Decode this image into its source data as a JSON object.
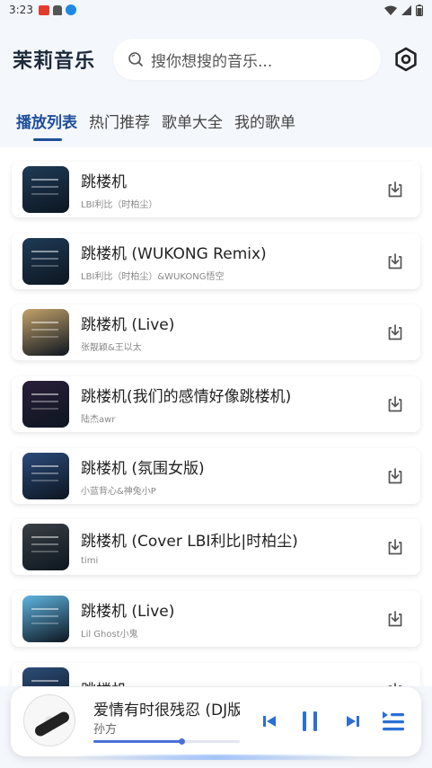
{
  "status_bar": {
    "time": "3:23"
  },
  "header": {
    "app_title": "茉莉音乐",
    "search_placeholder": "搜你想搜的音乐...",
    "settings_icon": "settings-hexagon-icon"
  },
  "tabs": [
    {
      "label": "播放列表",
      "active": true
    },
    {
      "label": "热门推荐",
      "active": false
    },
    {
      "label": "歌单大全",
      "active": false
    },
    {
      "label": "我的歌单",
      "active": false
    }
  ],
  "songs": [
    {
      "title": "跳楼机",
      "artist": "LBI利比（时柏尘）",
      "cover_color": "#1e3b57"
    },
    {
      "title": "跳楼机 (WUKONG Remix)",
      "artist": "LBI利比（时柏尘）&WUKONG悟空",
      "cover_color": "#1e3b57"
    },
    {
      "title": "跳楼机 (Live)",
      "artist": "张靓颖&王以太",
      "cover_color": "#c4a26a"
    },
    {
      "title": "跳楼机(我们的感情好像跳楼机)",
      "artist": "陆杰awr",
      "cover_color": "#2a1e3a"
    },
    {
      "title": "跳楼机 (氛围女版)",
      "artist": "小蓝背心&神兔小P",
      "cover_color": "#2b4a7a"
    },
    {
      "title": "跳楼机 (Cover LBI利比|时柏尘)",
      "artist": "timi",
      "cover_color": "#3a3f44"
    },
    {
      "title": "跳楼机 (Live)",
      "artist": "Lil Ghost小鬼",
      "cover_color": "#5fb4e0"
    },
    {
      "title": "跳楼机",
      "artist": "",
      "cover_color": "#2c4d78"
    }
  ],
  "player": {
    "title": "爱情有时很残忍 (DJ版)",
    "artist": "孙方",
    "progress": 0.6
  },
  "colors": {
    "accent": "#1f4f9a",
    "control": "#2b6fd6"
  }
}
